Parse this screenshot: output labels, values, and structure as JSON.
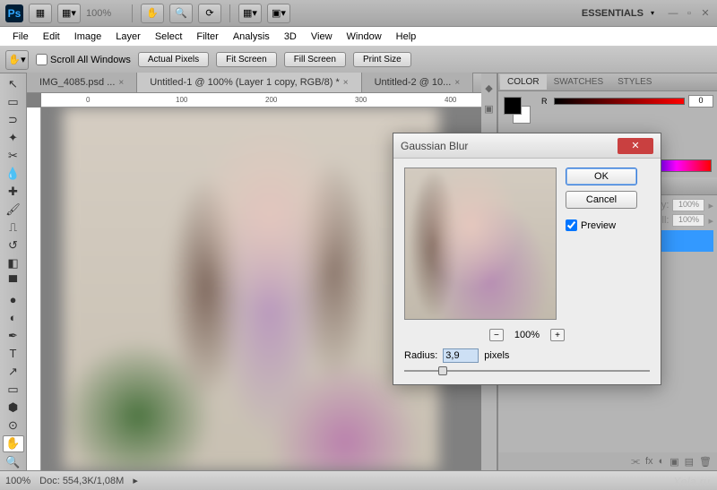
{
  "app": {
    "workspace_label": "ESSENTIALS",
    "zoom_display": "100%"
  },
  "menu": [
    "File",
    "Edit",
    "Image",
    "Layer",
    "Select",
    "Filter",
    "Analysis",
    "3D",
    "View",
    "Window",
    "Help"
  ],
  "options": {
    "scroll_all": "Scroll All Windows",
    "buttons": [
      "Actual Pixels",
      "Fit Screen",
      "Fill Screen",
      "Print Size"
    ]
  },
  "doc_tabs": [
    {
      "label": "IMG_4085.psd ...",
      "active": false
    },
    {
      "label": "Untitled-1 @ 100% (Layer 1 copy, RGB/8) *",
      "active": true
    },
    {
      "label": "Untitled-2 @ 10...",
      "active": false
    }
  ],
  "ruler_marks": [
    "0",
    "100",
    "200",
    "300",
    "400"
  ],
  "panels": {
    "color_tabs": [
      "COLOR",
      "SWATCHES",
      "STYLES"
    ],
    "color_active": 0,
    "r_value": "0",
    "layer_tab": "HS",
    "opacity_label": "acity:",
    "opacity_val": "100%",
    "fill_label": "Fill:",
    "fill_val": "100%"
  },
  "dialog": {
    "title": "Gaussian Blur",
    "ok": "OK",
    "cancel": "Cancel",
    "preview": "Preview",
    "zoom": "100%",
    "radius_label": "Radius:",
    "radius_value": "3,9",
    "radius_unit": "pixels"
  },
  "status": {
    "zoom": "100%",
    "doc": "Doc: 554,3K/1,08M"
  },
  "watermark": "Xela.ru"
}
